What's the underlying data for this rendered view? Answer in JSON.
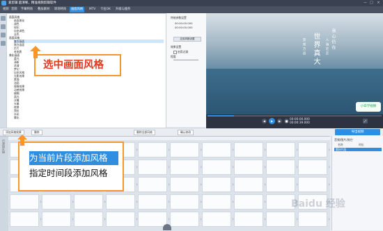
{
  "window": {
    "title": "爱剪辑  超清晰，精准视频剪辑软件",
    "min": "—",
    "max": "□",
    "close": "×"
  },
  "menu_tabs": [
    "视频",
    "音频",
    "字幕特效",
    "叠加素材",
    "转场特效",
    "画面风格",
    "MTV",
    "卡拉OK",
    "升级与服务"
  ],
  "active_menu_tab": "画面风格",
  "tree": {
    "rows": [
      {
        "text": "画面风格",
        "type": "grp"
      },
      {
        "text": "画面美化",
        "type": "item"
      },
      {
        "text": "调色",
        "type": "item"
      },
      {
        "text": "锐化",
        "type": "item"
      },
      {
        "text": "自由调色",
        "type": "item"
      },
      {
        "text": "去色",
        "type": "item"
      },
      {
        "text": "画面风格",
        "type": "grp"
      },
      {
        "text": "复古画面",
        "type": "item"
      },
      {
        "text": "黑白画面",
        "type": "item"
      },
      {
        "text": "负片",
        "type": "item"
      },
      {
        "text": "老电影",
        "type": "item"
      },
      {
        "text": "美化画面",
        "type": "grp"
      },
      {
        "text": "柔光",
        "type": "item"
      },
      {
        "text": "清新",
        "type": "item"
      },
      {
        "text": "浪漫",
        "type": "item"
      },
      {
        "text": "梦幻",
        "type": "item"
      },
      {
        "text": "自由风格",
        "type": "item"
      },
      {
        "text": "光影效果",
        "type": "item"
      },
      {
        "text": "素描",
        "type": "item"
      },
      {
        "text": "油画",
        "type": "item"
      },
      {
        "text": "镜像效果",
        "type": "item"
      },
      {
        "text": "动感效果",
        "type": "item"
      },
      {
        "text": "模糊",
        "type": "item"
      },
      {
        "text": "高光",
        "type": "item"
      },
      {
        "text": "浮雕",
        "type": "item"
      },
      {
        "text": "光晕",
        "type": "item"
      },
      {
        "text": "夜景",
        "type": "item"
      },
      {
        "text": "霓虹",
        "type": "item"
      },
      {
        "text": "水彩",
        "type": "item"
      },
      {
        "text": "雾化",
        "type": "item"
      }
    ],
    "selected_index": 7
  },
  "callout_select_style": "选中画面风格",
  "props": {
    "title1": "特效参数设置",
    "line1": "00:00:00.000",
    "line2": "00:00:00.000",
    "apply_btn": "应用风格设置",
    "title2": "效果设置",
    "checkbox": "启用过渡",
    "slider_label": "程度"
  },
  "preview": {
    "poem_big": "世界真大",
    "poem_small1": "我心仍在",
    "poem_small2": "人海茫茫",
    "poem_small3": "游戏万语",
    "watermark": "小白学视频"
  },
  "controls": {
    "time_current": "00:00:00.000",
    "time_total": "00:00:39.000",
    "progress": 0.15
  },
  "toolbar": {
    "add_style": "添加风格效果",
    "delete": "删除",
    "clear_all": "删除全部风格",
    "confirm": "确认修改"
  },
  "export_btn": "导出视频",
  "timeline_side": {
    "header": "音频/图片/其它",
    "col1": "名称",
    "col2": "时长",
    "row1": "素材片段"
  },
  "timeline_tab": "已添加片段",
  "callout_menu": {
    "item1": "为当前片段添加风格",
    "item2": "指定时间段添加风格"
  },
  "watermark_site": "Baidu 经验",
  "colors": {
    "accent": "#2f8ee0",
    "callout_border": "#f6962c",
    "callout_text": "#e8351b"
  }
}
